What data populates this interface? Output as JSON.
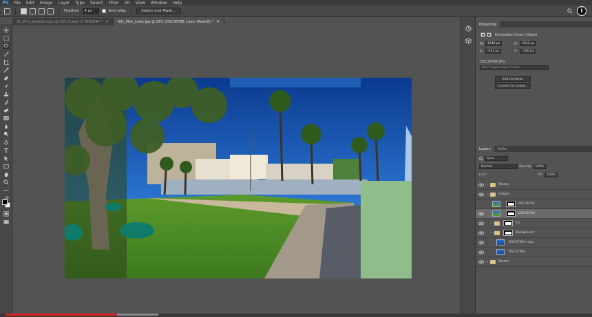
{
  "app": {
    "logo": "Ps",
    "menu": [
      "File",
      "Edit",
      "Image",
      "Layer",
      "Type",
      "Select",
      "Filter",
      "3D",
      "View",
      "Window",
      "Help"
    ]
  },
  "options": {
    "feather_label": "Feather:",
    "feather_value": "4 px",
    "antialias_label": "Anti-alias",
    "select_mask_label": "Select and Mask..."
  },
  "info_badge": "i",
  "tabs": [
    {
      "label": "01_Mim_Sample copy @ 50% (Layer 0, RGB/8#) *",
      "close": "×"
    },
    {
      "label": "001_Mim_Lines.jpg @ 25% (DSC36786, Layer Mask/8) *",
      "close": "×"
    }
  ],
  "properties": {
    "tabs": [
      "Properties"
    ],
    "type": "Embedded Smart Object",
    "w_label": "W:",
    "w_value": "4240 px",
    "h_label": "H:",
    "h_value": "2832 px",
    "x_label": "X:",
    "x_value": "-912 px",
    "y_label": "Y:",
    "y_value": "-336 px",
    "filename": "DSC36786.JPG",
    "comp_placeholder": "Don't Apply Layer Comp",
    "edit_contents": "Edit Contents",
    "convert_linked": "Convert to Linked..."
  },
  "layers": {
    "tabs": [
      "Layers",
      "Paths"
    ],
    "filter_label": "Kind",
    "blend_mode": "Normal",
    "opacity_label": "Opacity:",
    "opacity_value": "100%",
    "lock_label": "Lock:",
    "fill_label": "Fill:",
    "fill_value": "100%",
    "rows": [
      {
        "name": "Passes",
        "kind": "group"
      },
      {
        "name": "Images",
        "kind": "group"
      },
      {
        "name": "DSC36724",
        "kind": "smart-mask"
      },
      {
        "name": "DSC36786",
        "kind": "smart-mask",
        "selected": true
      },
      {
        "name": "FG",
        "kind": "group-mask"
      },
      {
        "name": "Background",
        "kind": "group-mask"
      },
      {
        "name": "DSC37394 copy",
        "kind": "smart"
      },
      {
        "name": "DSC37394",
        "kind": "smart"
      },
      {
        "name": "Render",
        "kind": "group"
      }
    ]
  },
  "timeline": {
    "progress": 0.19,
    "buffered": 0.26
  },
  "colors": {
    "accent": "#49a7ff",
    "progress": "#e02121",
    "patch_green": "#8fbd8c"
  }
}
